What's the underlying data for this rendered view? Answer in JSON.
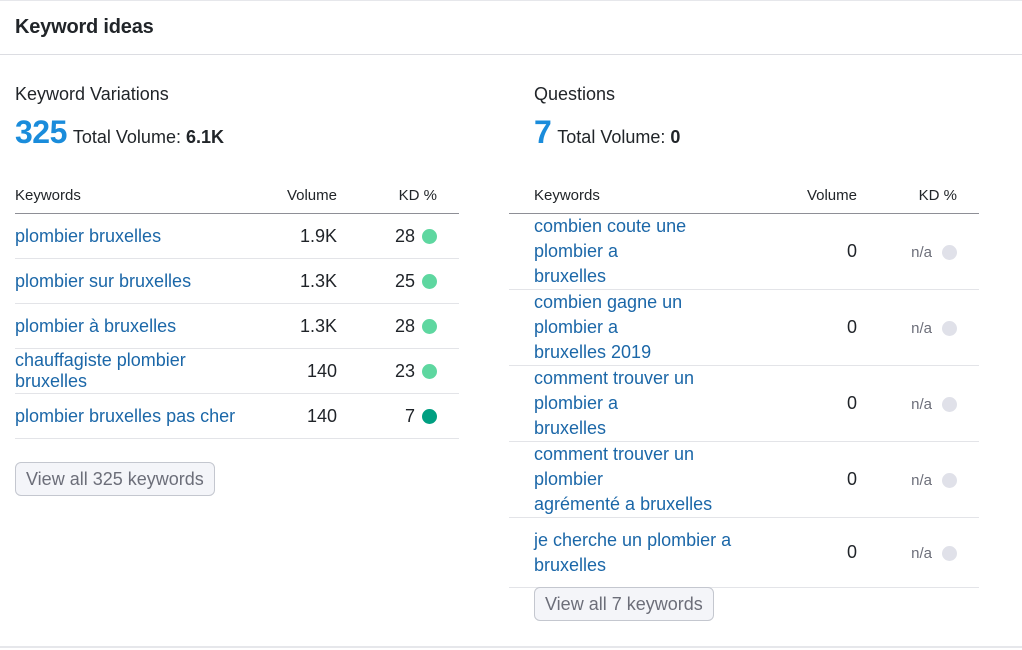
{
  "header": {
    "title": "Keyword ideas"
  },
  "variations": {
    "title": "Keyword Variations",
    "count": "325",
    "total_volume_label": "Total Volume:",
    "total_volume_value": "6.1K",
    "columns": {
      "keyword": "Keywords",
      "volume": "Volume",
      "kd": "KD %"
    },
    "rows": [
      {
        "keyword": "plombier bruxelles",
        "volume": "1.9K",
        "kd": "28",
        "kd_color": "#5ed7a0"
      },
      {
        "keyword": "plombier sur bruxelles",
        "volume": "1.3K",
        "kd": "25",
        "kd_color": "#5ed7a0"
      },
      {
        "keyword": "plombier à bruxelles",
        "volume": "1.3K",
        "kd": "28",
        "kd_color": "#5ed7a0"
      },
      {
        "keyword": "chauffagiste plombier bruxelles",
        "volume": "140",
        "kd": "23",
        "kd_color": "#5ed7a0"
      },
      {
        "keyword": "plombier bruxelles pas cher",
        "volume": "140",
        "kd": "7",
        "kd_color": "#009f81"
      }
    ],
    "button_label": "View all 325 keywords"
  },
  "questions": {
    "title": "Questions",
    "count": "7",
    "total_volume_label": "Total Volume:",
    "total_volume_value": "0",
    "columns": {
      "keyword": "Keywords",
      "volume": "Volume",
      "kd": "KD %"
    },
    "rows": [
      {
        "line1": "combien coute une plombier a",
        "line2": "bruxelles",
        "volume": "0",
        "kd": "n/a",
        "kd_color": "#e0e1e9"
      },
      {
        "line1": "combien gagne un plombier a",
        "line2": "bruxelles 2019",
        "volume": "0",
        "kd": "n/a",
        "kd_color": "#e0e1e9"
      },
      {
        "line1": "comment trouver un plombier a",
        "line2": "bruxelles",
        "volume": "0",
        "kd": "n/a",
        "kd_color": "#e0e1e9"
      },
      {
        "line1": "comment trouver un plombier",
        "line2": "agrémenté a bruxelles",
        "volume": "0",
        "kd": "n/a",
        "kd_color": "#e0e1e9"
      },
      {
        "line1": "je cherche un plombier a",
        "line2": "bruxelles",
        "volume": "0",
        "kd": "n/a",
        "kd_color": "#e0e1e9"
      }
    ],
    "button_label": "View all 7 keywords"
  }
}
